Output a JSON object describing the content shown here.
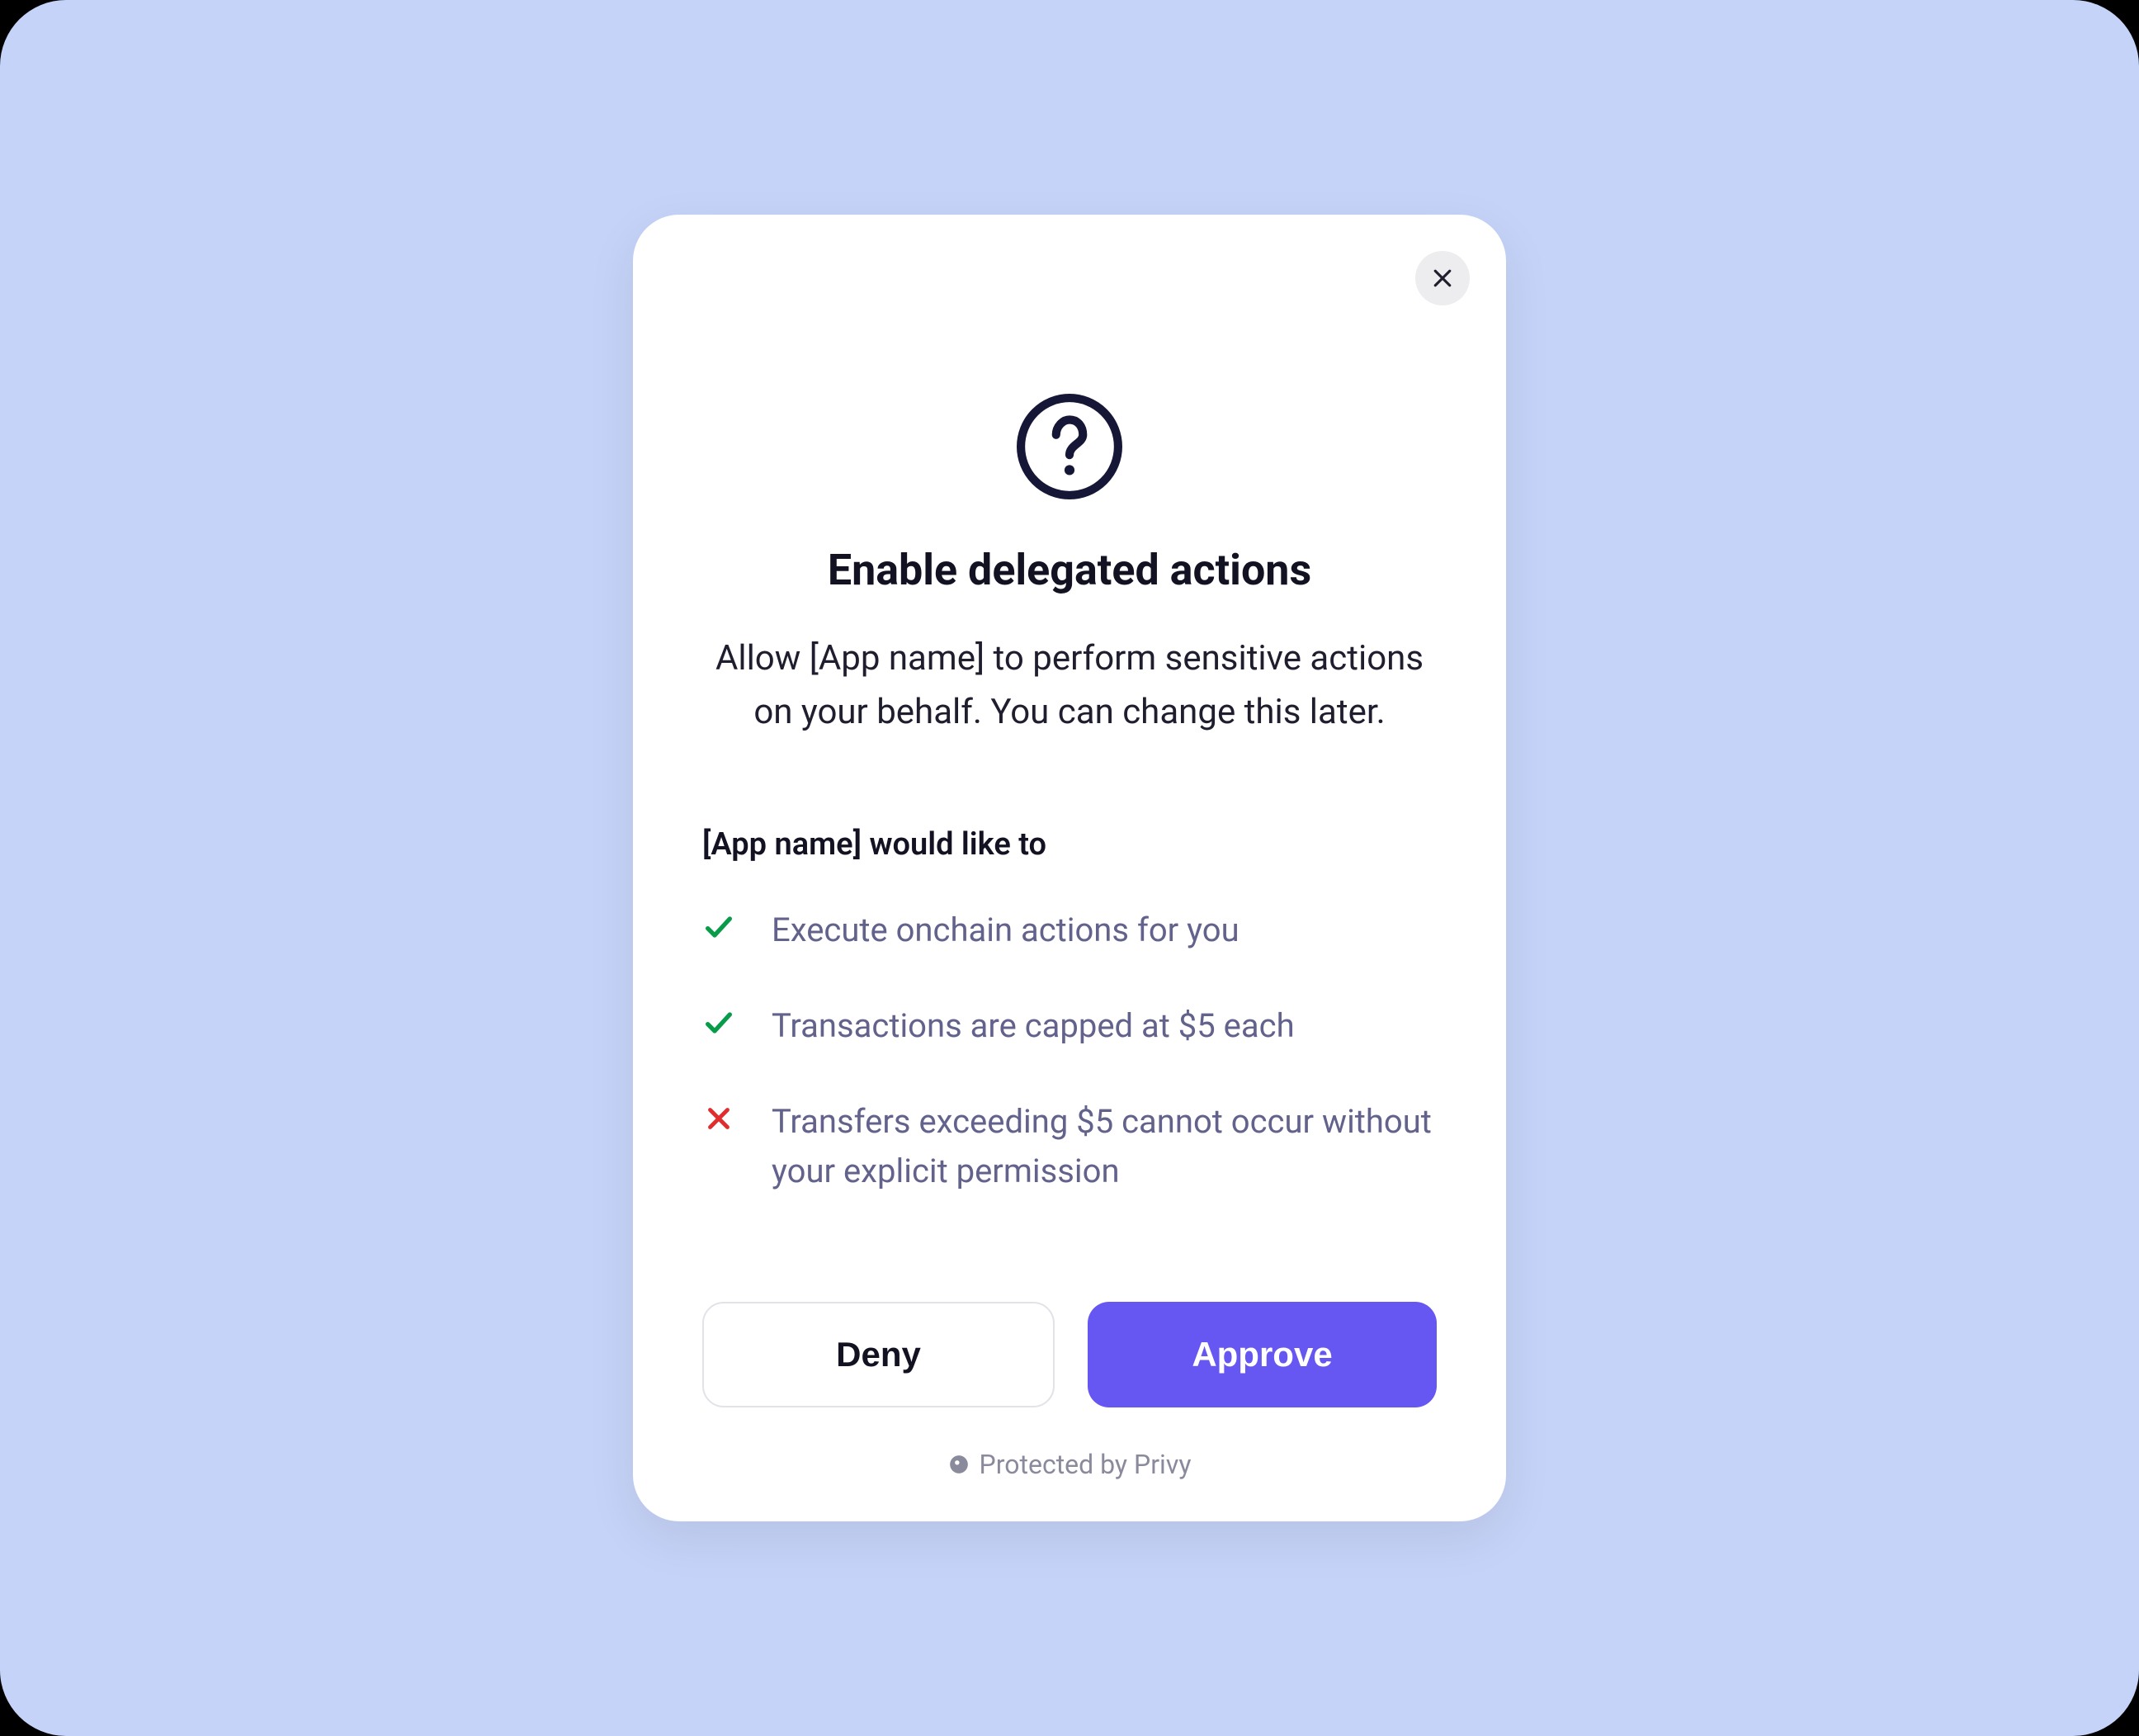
{
  "modal": {
    "title": "Enable delegated actions",
    "description": "Allow [App name] to perform sensitive actions on your behalf. You can change this later.",
    "permissions": {
      "title": "[App name] would like to",
      "items": [
        {
          "icon": "check",
          "text": "Execute onchain actions for you"
        },
        {
          "icon": "check",
          "text": "Transactions are capped at $5 each"
        },
        {
          "icon": "cross",
          "text": "Transfers exceeding $5 cannot occur without your explicit permission"
        }
      ]
    },
    "buttons": {
      "deny": "Deny",
      "approve": "Approve"
    },
    "footer": "Protected by Privy"
  },
  "colors": {
    "background": "#c5d3f8",
    "modal_bg": "#ffffff",
    "primary": "#6656f2",
    "text_dark": "#121222",
    "text_muted": "#62628c",
    "check_green": "#089b4a",
    "cross_red": "#e02e2e"
  }
}
